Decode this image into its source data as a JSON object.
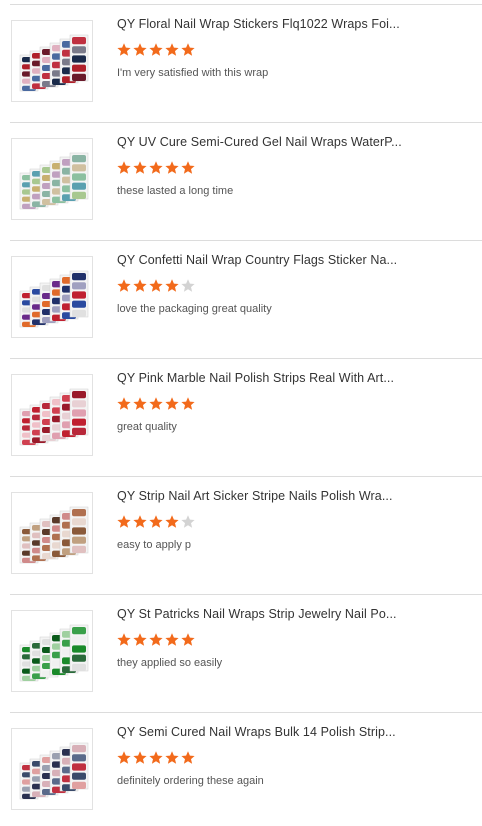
{
  "colors": {
    "star_filled": "#f26a1b",
    "star_empty": "#d3d3d3",
    "divider": "#dcdcdc",
    "title_text": "#333333",
    "review_text": "#555555"
  },
  "reviews": [
    {
      "title": "QY Floral Nail Wrap Stickers Flq1022 Wraps Foi...",
      "rating": 5,
      "review": "I'm very satisfied with this wrap",
      "thumb_palette": [
        "#1a2a4a",
        "#b0202a",
        "#6a1a2a",
        "#e0b0c0",
        "#4a6aa0",
        "#c03040",
        "#7a7a8a"
      ]
    },
    {
      "title": "QY UV Cure Semi-Cured Gel Nail Wraps WaterP...",
      "rating": 5,
      "review": "these lasted a long time",
      "thumb_palette": [
        "#8cc0a0",
        "#5aa0b0",
        "#a8c890",
        "#c8b070",
        "#c0a0c0",
        "#8ab4a4",
        "#d0c0a0"
      ]
    },
    {
      "title": "QY Confetti Nail Wrap Country Flags Sticker Na...",
      "rating": 4,
      "review": "love the packaging great quality",
      "thumb_palette": [
        "#c02030",
        "#2a4aa0",
        "#e0e0e0",
        "#6a2a8a",
        "#e06a2a",
        "#20306a",
        "#a0a0c0"
      ]
    },
    {
      "title": "QY Pink Marble Nail Polish Strips Real With Art...",
      "rating": 5,
      "review": "great quality",
      "thumb_palette": [
        "#e0a0b0",
        "#c02030",
        "#b8283a",
        "#f0c0c8",
        "#d04050",
        "#9a1a2a",
        "#e8d0d4"
      ]
    },
    {
      "title": "QY Strip Nail Art Sicker Stripe Nails Polish Wra...",
      "rating": 4,
      "review": "easy to apply p",
      "thumb_palette": [
        "#8a5a3a",
        "#c0a080",
        "#e0c0c0",
        "#5a3a2a",
        "#d08a8a",
        "#b07050",
        "#e8d8d0"
      ]
    },
    {
      "title": "QY St Patricks Nail Wraps Strip Jewelry Nail Po...",
      "rating": 5,
      "review": "they applied so easily",
      "thumb_palette": [
        "#1a8a2a",
        "#2a6a3a",
        "#e0e0e0",
        "#0a5a1a",
        "#a0d0a0",
        "#3aa04a",
        "#f0f0f0"
      ]
    },
    {
      "title": "QY Semi Cured Nail Wraps Bulk 14 Polish Strip...",
      "rating": 5,
      "review": "definitely ordering these again",
      "thumb_palette": [
        "#c03040",
        "#3a4a6a",
        "#e0a0a0",
        "#9aa0b0",
        "#2a3050",
        "#d8b0b8",
        "#5a6a8a"
      ]
    }
  ]
}
